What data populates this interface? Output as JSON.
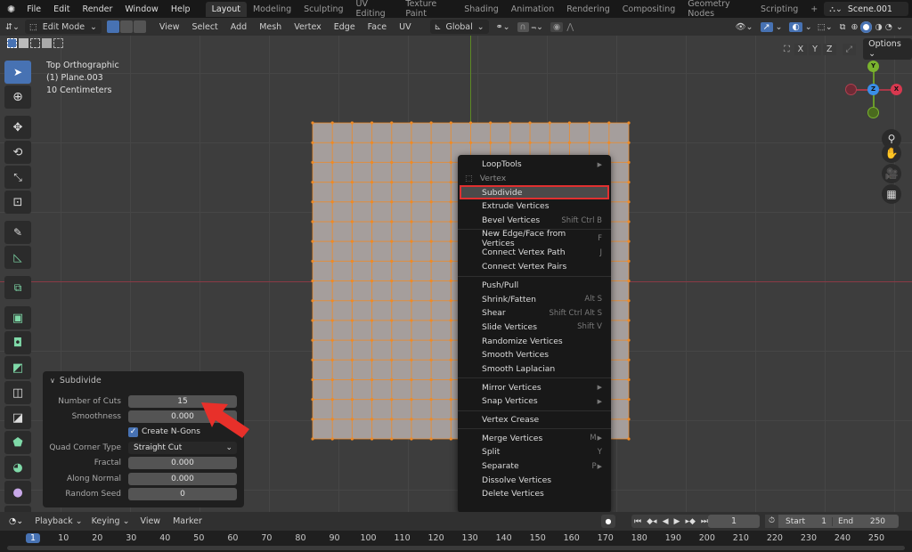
{
  "topbar": {
    "menus": [
      "File",
      "Edit",
      "Render",
      "Window",
      "Help"
    ],
    "workspaces": [
      "Layout",
      "Modeling",
      "Sculpting",
      "UV Editing",
      "Texture Paint",
      "Shading",
      "Animation",
      "Rendering",
      "Compositing",
      "Geometry Nodes",
      "Scripting"
    ],
    "active_workspace": "Layout",
    "add_workspace": "+",
    "scene": "Scene.001"
  },
  "header": {
    "mode": "Edit Mode",
    "menus": [
      "View",
      "Select",
      "Add",
      "Mesh",
      "Vertex",
      "Edge",
      "Face",
      "UV"
    ],
    "transform_orientation": "Global",
    "axes": [
      "X",
      "Y",
      "Z"
    ],
    "options": "Options"
  },
  "viewport": {
    "view_name": "Top Orthographic",
    "object": "(1) Plane.003",
    "scale": "10 Centimeters",
    "mesh_cuts": 15,
    "colors": {
      "vertex": "#f08a24",
      "face": "#a59e9c",
      "x_axis": "#a83848",
      "y_axis": "#6a9a2a"
    }
  },
  "gizmo": {
    "x": "X",
    "y": "Y",
    "z": "Z"
  },
  "context_menu": {
    "items": [
      {
        "label": "LoopTools",
        "shortcut": "",
        "submenu": true
      },
      {
        "label": "Vertex",
        "header": true
      },
      {
        "label": "Subdivide",
        "shortcut": "",
        "highlighted": true
      },
      {
        "label": "Extrude Vertices",
        "shortcut": ""
      },
      {
        "label": "Bevel Vertices",
        "shortcut": "Shift Ctrl B"
      },
      {
        "sep": true
      },
      {
        "label": "New Edge/Face from Vertices",
        "shortcut": "F"
      },
      {
        "label": "Connect Vertex Path",
        "shortcut": "J"
      },
      {
        "label": "Connect Vertex Pairs",
        "shortcut": ""
      },
      {
        "sep": true
      },
      {
        "label": "Push/Pull",
        "shortcut": ""
      },
      {
        "label": "Shrink/Fatten",
        "shortcut": "Alt S"
      },
      {
        "label": "Shear",
        "shortcut": "Shift Ctrl Alt S"
      },
      {
        "label": "Slide Vertices",
        "shortcut": "Shift V"
      },
      {
        "label": "Randomize Vertices",
        "shortcut": ""
      },
      {
        "label": "Smooth Vertices",
        "shortcut": ""
      },
      {
        "label": "Smooth Laplacian",
        "shortcut": ""
      },
      {
        "sep": true
      },
      {
        "label": "Mirror Vertices",
        "shortcut": "",
        "submenu": true
      },
      {
        "label": "Snap Vertices",
        "shortcut": "",
        "submenu": true
      },
      {
        "sep": true
      },
      {
        "label": "Vertex Crease",
        "shortcut": ""
      },
      {
        "sep": true
      },
      {
        "label": "Merge Vertices",
        "shortcut": "M",
        "submenu": true
      },
      {
        "label": "Split",
        "shortcut": "Y"
      },
      {
        "label": "Separate",
        "shortcut": "P",
        "submenu": true
      },
      {
        "label": "Dissolve Vertices",
        "shortcut": ""
      },
      {
        "label": "Delete Vertices",
        "shortcut": ""
      }
    ]
  },
  "operator_panel": {
    "title": "Subdivide",
    "number_of_cuts_label": "Number of Cuts",
    "number_of_cuts": "15",
    "smoothness_label": "Smoothness",
    "smoothness": "0.000",
    "create_ngons_label": "Create N-Gons",
    "create_ngons": true,
    "quad_corner_label": "Quad Corner Type",
    "quad_corner": "Straight Cut",
    "fractal_label": "Fractal",
    "fractal": "0.000",
    "along_normal_label": "Along Normal",
    "along_normal": "0.000",
    "random_seed_label": "Random Seed",
    "random_seed": "0"
  },
  "timeline": {
    "menus": [
      "Playback",
      "Keying",
      "View",
      "Marker"
    ],
    "current_frame": "1",
    "start_label": "Start",
    "start": "1",
    "end_label": "End",
    "end": "250",
    "ticks": [
      "1",
      "10",
      "20",
      "30",
      "40",
      "50",
      "60",
      "70",
      "80",
      "90",
      "100",
      "110",
      "120",
      "130",
      "140",
      "150",
      "160",
      "170",
      "180",
      "190",
      "200",
      "210",
      "220",
      "230",
      "240",
      "250"
    ]
  },
  "annotation": {
    "arrow_color": "#e8302a"
  }
}
